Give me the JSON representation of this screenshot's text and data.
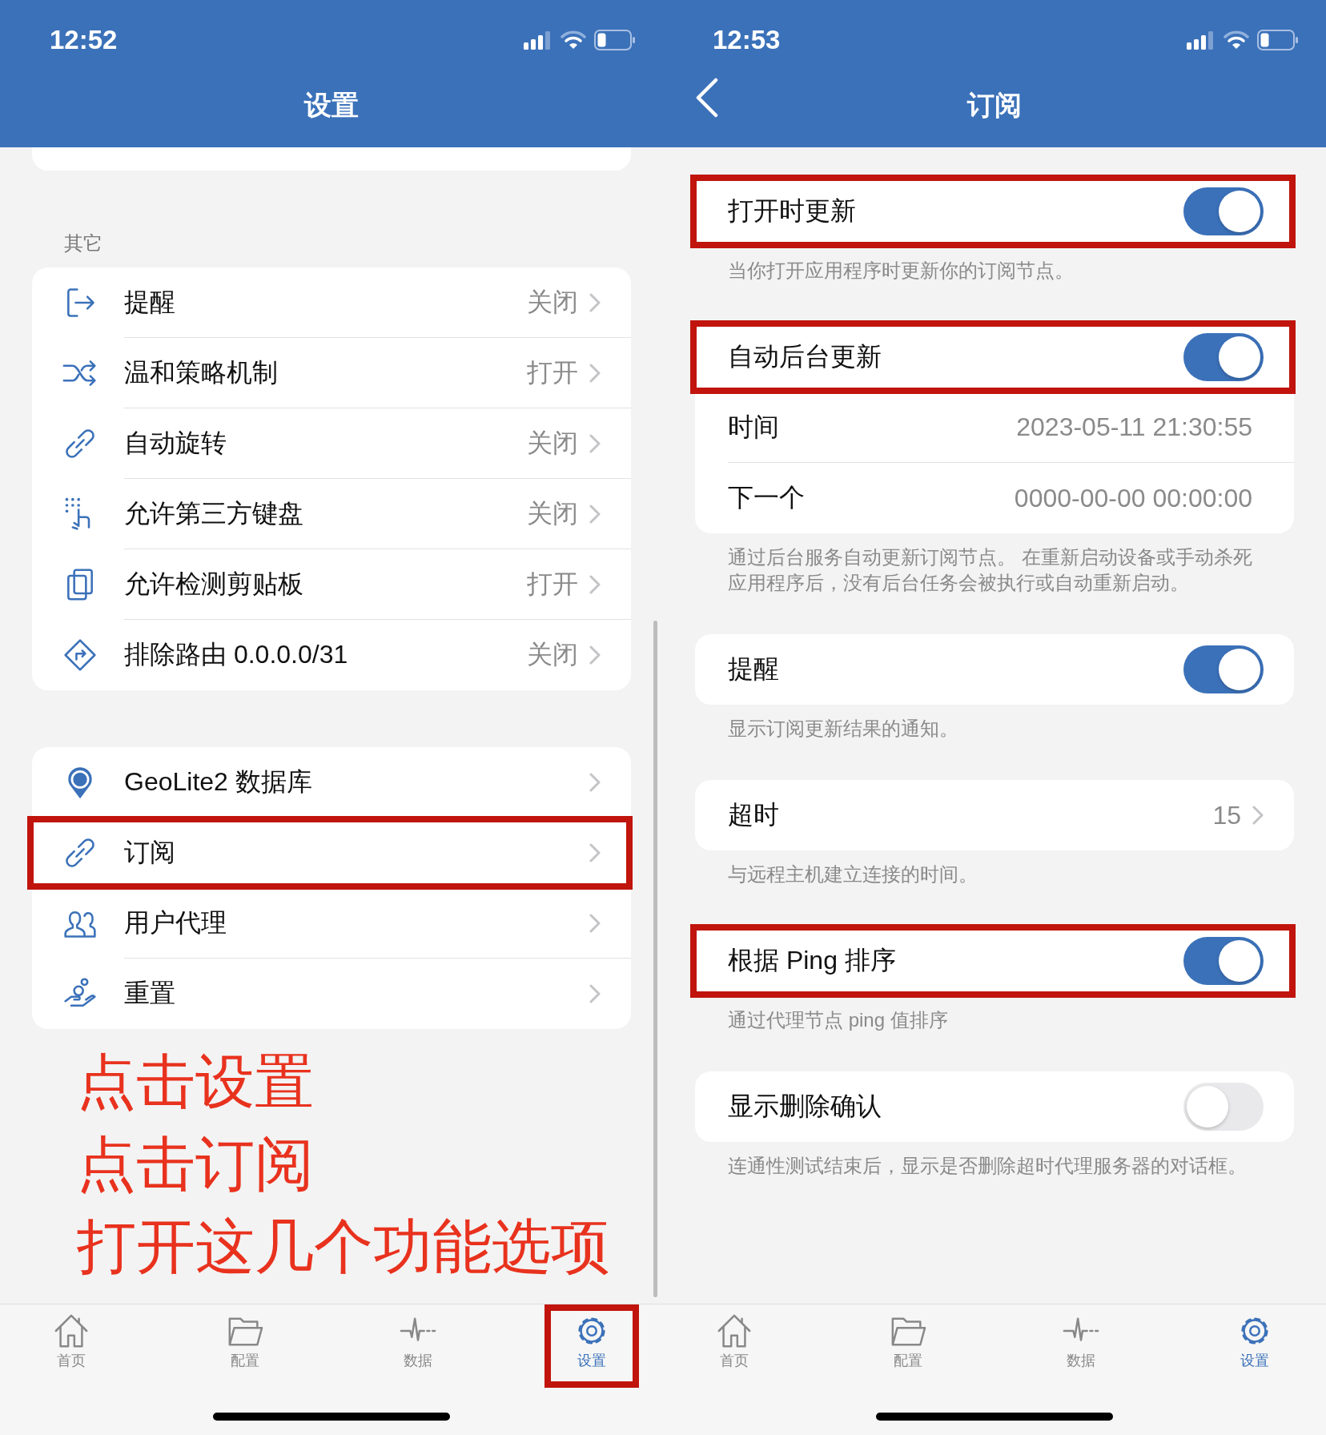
{
  "screens": [
    {
      "status": {
        "time": "12:52"
      },
      "nav": {
        "title": "设置",
        "back": false
      },
      "sections": [
        {
          "kind": "clipped"
        },
        {
          "kind": "card",
          "header": "其它",
          "rows": [
            {
              "kind": "link",
              "label": "提醒",
              "value": "关闭",
              "highlighted": false
            },
            {
              "kind": "link",
              "label": "温和策略机制",
              "value": "打开",
              "highlighted": false
            },
            {
              "kind": "link",
              "label": "自动旋转",
              "value": "关闭",
              "highlighted": false
            },
            {
              "kind": "link",
              "label": "允许第三方键盘",
              "value": "关闭",
              "highlighted": false
            },
            {
              "kind": "link",
              "label": "允许检测剪贴板",
              "value": "打开",
              "highlighted": false
            },
            {
              "kind": "link",
              "label": "排除路由 0.0.0.0/31",
              "value": "关闭",
              "highlighted": false
            }
          ]
        },
        {
          "kind": "card",
          "rows": [
            {
              "kind": "link",
              "label": "GeoLite2 数据库",
              "highlighted": false
            },
            {
              "kind": "link",
              "label": "订阅",
              "highlighted": true
            },
            {
              "kind": "link",
              "label": "用户代理",
              "highlighted": false
            },
            {
              "kind": "link",
              "label": "重置",
              "highlighted": false
            }
          ]
        }
      ],
      "annotations": [
        "点击设置",
        "点击订阅",
        "打开这几个功能选项"
      ],
      "tabs": [
        {
          "label": "首页",
          "selected": false,
          "highlighted": false
        },
        {
          "label": "配置",
          "selected": false,
          "highlighted": false
        },
        {
          "label": "数据",
          "selected": false,
          "highlighted": false
        },
        {
          "label": "设置",
          "selected": true,
          "highlighted": true
        }
      ]
    },
    {
      "status": {
        "time": "12:53"
      },
      "nav": {
        "title": "订阅",
        "back": true
      },
      "sections": [
        {
          "kind": "card",
          "rows": [
            {
              "kind": "toggle",
              "label": "打开时更新",
              "on": true,
              "highlighted": true
            }
          ],
          "footer": "当你打开应用程序时更新你的订阅节点。"
        },
        {
          "kind": "card",
          "rows": [
            {
              "kind": "toggle",
              "label": "自动后台更新",
              "on": true,
              "highlighted": true
            },
            {
              "kind": "info",
              "label": "时间",
              "value": "2023-05-11 21:30:55",
              "highlighted": false
            },
            {
              "kind": "info",
              "label": "下一个",
              "value": "0000-00-00 00:00:00",
              "highlighted": false
            }
          ],
          "footer": "通过后台服务自动更新订阅节点。 在重新启动设备或手动杀死应用程序后，没有后台任务会被执行或自动重新启动。"
        },
        {
          "kind": "card",
          "rows": [
            {
              "kind": "toggle",
              "label": "提醒",
              "on": true,
              "highlighted": false
            }
          ],
          "footer": "显示订阅更新结果的通知。"
        },
        {
          "kind": "card",
          "rows": [
            {
              "kind": "link",
              "label": "超时",
              "value": "15",
              "highlighted": false
            }
          ],
          "footer": "与远程主机建立连接的时间。"
        },
        {
          "kind": "card",
          "rows": [
            {
              "kind": "toggle",
              "label": "根据 Ping 排序",
              "on": true,
              "highlighted": true
            }
          ],
          "footer": "通过代理节点 ping 值排序"
        },
        {
          "kind": "card",
          "rows": [
            {
              "kind": "toggle",
              "label": "显示删除确认",
              "on": false,
              "highlighted": false
            }
          ],
          "footer": "连通性测试结束后，显示是否删除超时代理服务器的对话框。"
        }
      ],
      "tabs": [
        {
          "label": "首页",
          "selected": false,
          "highlighted": false
        },
        {
          "label": "配置",
          "selected": false,
          "highlighted": false
        },
        {
          "label": "数据",
          "selected": false,
          "highlighted": false
        },
        {
          "label": "设置",
          "selected": true,
          "highlighted": false
        }
      ]
    }
  ]
}
